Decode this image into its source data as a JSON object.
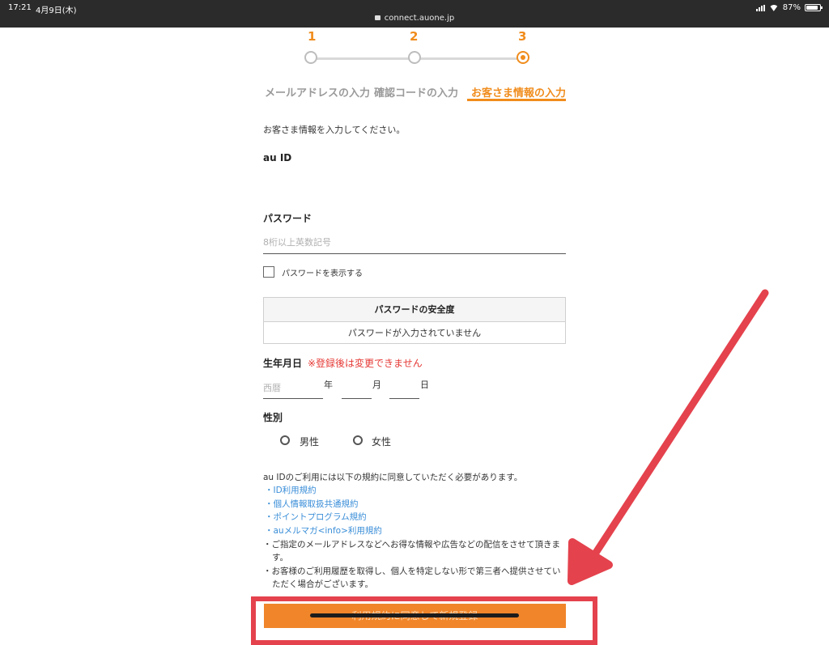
{
  "status_bar": {
    "time": "17:21",
    "date": "4月9日(木)",
    "url": "connect.auone.jp",
    "battery": "87%"
  },
  "stepper": {
    "steps": [
      {
        "number": "1",
        "label": "メールアドレスの入力"
      },
      {
        "number": "2",
        "label": "確認コードの入力"
      },
      {
        "number": "3",
        "label": "お客さま情報の入力"
      }
    ],
    "active_index": 2,
    "colors": {
      "active": "#f08c1c",
      "inactive": "#9a9a9a"
    }
  },
  "form": {
    "intro": "お客さま情報を入力してください。",
    "au_id_label": "au ID",
    "password_label": "パスワード",
    "password_placeholder": "8桁以上英数記号",
    "show_password_label": "パスワードを表示する",
    "strength_title": "パスワードの安全度",
    "strength_status": "パスワードが入力されていません",
    "birthday_label": "生年月日",
    "birthday_warning": "※登録後は変更できません",
    "birthday_year_placeholder": "西暦",
    "birthday_year_unit": "年",
    "birthday_month_unit": "月",
    "birthday_day_unit": "日",
    "gender_label": "性別",
    "gender_male": "男性",
    "gender_female": "女性",
    "terms_intro": "au IDのご利用には以下の規約に同意していただく必要があります。",
    "terms_links": [
      "・ID利用規約",
      "・個人情報取扱共通規約",
      "・ポイントプログラム規約",
      "・auメルマガ<info>利用規約"
    ],
    "notice_1_line1": "・ご指定のメールアドレスなどへお得な情報や広告などの配信をさせて頂きま",
    "notice_1_line2": "す。",
    "notice_2_line1": "・お客様のご利用履歴を取得し、個人を特定しない形で第三者へ提供させてい",
    "notice_2_line2": "ただく場合がございます。",
    "submit_label": "利用規約に同意して新規登録"
  },
  "colors": {
    "accent": "#f08c1c",
    "link": "#3a8ed8",
    "warning": "#e53935",
    "annotation": "#e4424d",
    "button": "#f0852a"
  }
}
